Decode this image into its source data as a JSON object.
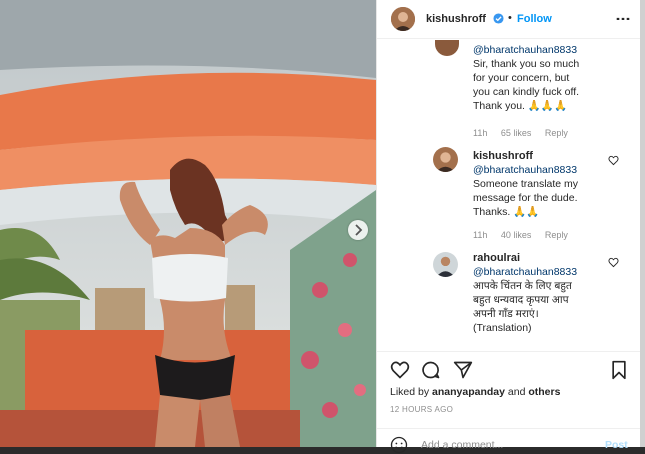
{
  "header": {
    "username": "kishushroff",
    "bullet": "•",
    "follow_label": "Follow",
    "more_label": "⋮"
  },
  "comments": [
    {
      "mention": "@bharatchauhan8833",
      "text_lines": [
        "Sir, thank you so much",
        "for your concern, but",
        "you can kindly fuck off.",
        "Thank you. 🙏🙏🙏"
      ],
      "time": "11h",
      "likes": "65 likes",
      "reply": "Reply"
    },
    {
      "username": "kishushroff",
      "mention": "@bharatchauhan8833",
      "text_lines": [
        "Someone translate my",
        "message for the dude.",
        "Thanks. 🙏🙏"
      ],
      "time": "11h",
      "likes": "40 likes",
      "reply": "Reply"
    },
    {
      "username": "rahoulrai",
      "mention": "@bharatchauhan8833",
      "text_lines": [
        "आपके चिंतन के लिए बहुत",
        "बहुत धन्यवाद कृपया आप",
        "अपनी गाँड मराएं।",
        "(Translation)"
      ]
    }
  ],
  "footer": {
    "liked_by_prefix": "Liked by",
    "liked_by_user": "ananyapanday",
    "liked_by_and": "and",
    "liked_by_others": "others",
    "timestamp": "12 HOURS AGO",
    "add_comment_placeholder": "Add a comment...",
    "post_label": "Post"
  },
  "colors": {
    "link": "#0095f6",
    "verified": "#3897f0"
  }
}
